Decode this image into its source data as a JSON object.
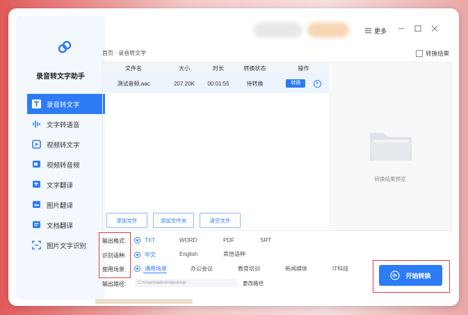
{
  "app": {
    "name": "录音转文字助手"
  },
  "sidebar": {
    "items": [
      {
        "label": "录音转文字",
        "icon": "text-T-icon",
        "active": true
      },
      {
        "label": "文字转语音",
        "icon": "waveform-icon",
        "active": false
      },
      {
        "label": "视频转文字",
        "icon": "video-play-icon",
        "active": false
      },
      {
        "label": "视频转音频",
        "icon": "video-audio-icon",
        "active": false
      },
      {
        "label": "文字翻译",
        "icon": "translate-icon",
        "active": false
      },
      {
        "label": "图片翻译",
        "icon": "image-translate-icon",
        "active": false
      },
      {
        "label": "文档翻译",
        "icon": "document-translate-icon",
        "active": false
      },
      {
        "label": "图片文字识别",
        "icon": "ocr-icon",
        "active": false
      }
    ]
  },
  "topbar": {
    "more_label": "更多"
  },
  "breadcrumb": "首页 · 录音转文字",
  "result_link": "转换结果",
  "table": {
    "headers": [
      "文件名",
      "大小",
      "时长",
      "转换状态",
      "操作"
    ],
    "rows": [
      {
        "name": "测试音频.aac",
        "size": "207.20K",
        "duration": "00:01:55",
        "status": "待转换",
        "action": "转换"
      }
    ]
  },
  "buttons": {
    "add_file": "添加文件",
    "add_folder": "添加文件夹",
    "clear_files": "清空文件"
  },
  "preview": {
    "text": "转换结果预览"
  },
  "options": {
    "format_label": "输出格式:",
    "formats": [
      "TXT",
      "WORD",
      "PDF",
      "SRT"
    ],
    "language_label": "识别语种:",
    "languages": [
      "中文",
      "English",
      "其他语种"
    ],
    "scene_label": "使用场景:",
    "scenes": [
      "通用场景",
      "办公会议",
      "教育培训",
      "新闻媒体",
      "IT科技"
    ],
    "path_label": "输出路径:",
    "path_value": "C:\\Users\\admin\\desktop",
    "change_path": "更改路径"
  },
  "start_button": "开始转换",
  "colors": {
    "accent": "#2d7bf6",
    "highlight": "#e53935"
  }
}
